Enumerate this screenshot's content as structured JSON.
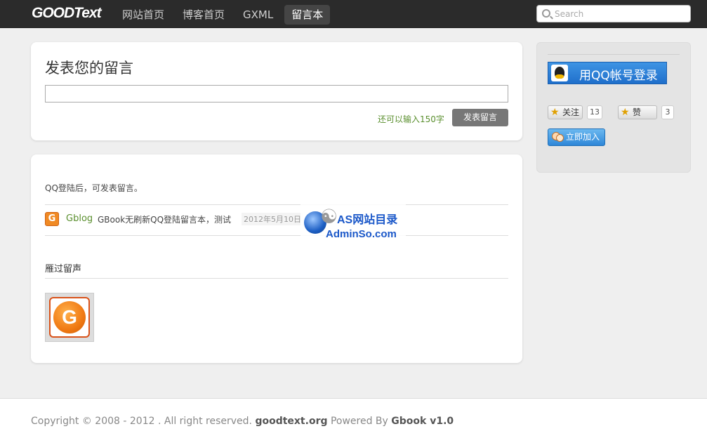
{
  "header": {
    "logo": "GOODText",
    "nav": [
      "网站首页",
      "博客首页",
      "GXML",
      "留言本"
    ],
    "active_nav": 3,
    "search_placeholder": "Search"
  },
  "post_form": {
    "title": "发表您的留言",
    "input_value": "",
    "char_hint": "还可以输入150字",
    "submit_label": "发表留言"
  },
  "messages": {
    "login_hint": "QQ登陆后，可发表留言。",
    "items": [
      {
        "avatar_letter": "G",
        "author": "Gblog",
        "content": "GBook无刷新QQ登陆留言本，测试",
        "date": "2012年5月10日"
      }
    ],
    "visitors_title": "雁过留声",
    "visitor_avatar_letter": "G"
  },
  "watermark": {
    "line1": "AS网站目录",
    "line2": "AdminSo.com"
  },
  "sidebar": {
    "qq_login_label": "用QQ帐号登录",
    "follow_label": "关注",
    "follow_count": "13",
    "like_label": "赞",
    "like_count": "3",
    "join_label": "立即加入"
  },
  "footer": {
    "copyright": "Copyright © 2008 - 2012 . All right reserved.",
    "site": "goodtext.org",
    "powered": "Powered By",
    "product": "Gbook v1.0"
  },
  "colors": {
    "topbar": "#2b2b2b",
    "accent_green": "#5a8f2e",
    "qq_blue": "#1f6fcb"
  }
}
